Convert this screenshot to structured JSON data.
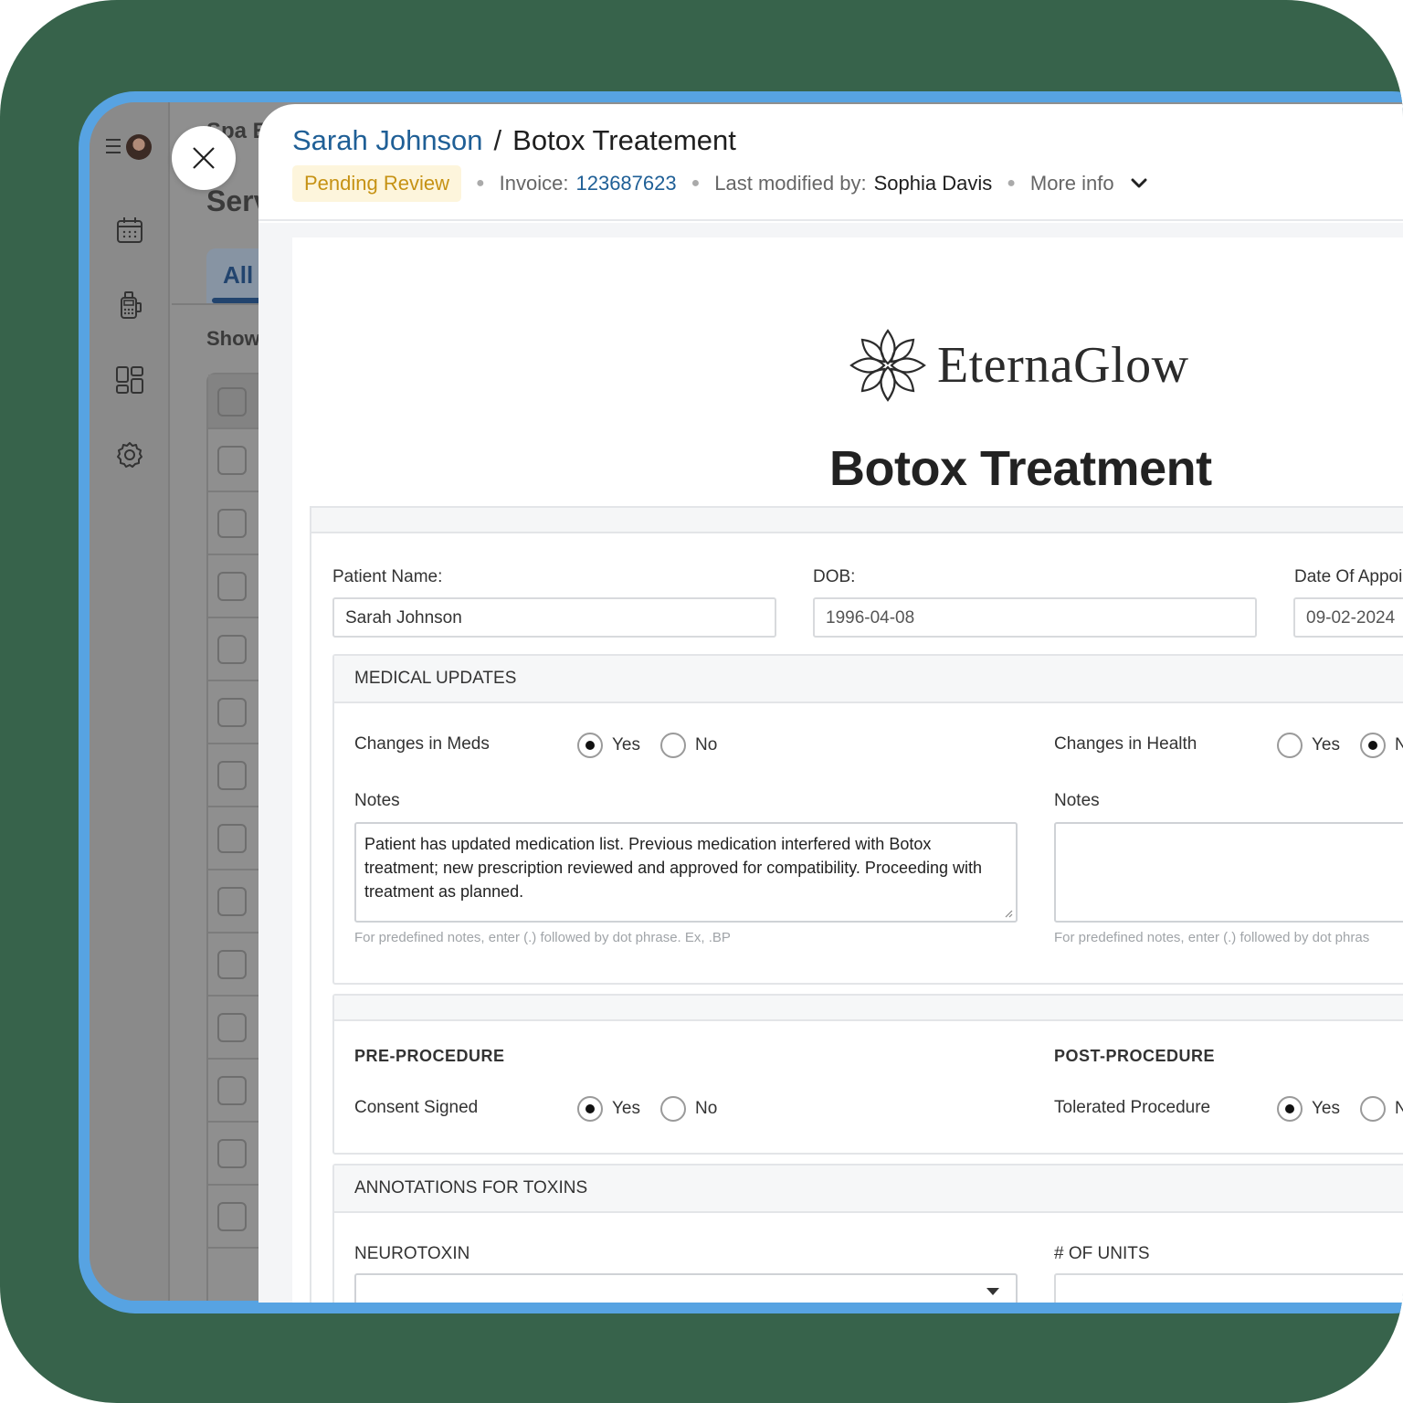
{
  "background_app": {
    "panel_title_partial": "Spa E",
    "heading_partial": "Serv",
    "active_tab_partial": "All",
    "show_partial": "Show",
    "rows": 14
  },
  "header": {
    "patient_name": "Sarah Johnson",
    "separator": "/",
    "form_title": "Botox Treatement",
    "status_badge": "Pending Review",
    "invoice_label": "Invoice:",
    "invoice_number": "123687623",
    "modified_label": "Last modified by:",
    "modified_by": "Sophia Davis",
    "more_info": "More info"
  },
  "document": {
    "brand_name": "EternaGlow",
    "title": "Botox Treatment",
    "patient_name_label": "Patient Name:",
    "patient_name_value": "Sarah Johnson",
    "dob_label": "DOB:",
    "dob_value": "1996-04-08",
    "appointment_label": "Date Of Appoi",
    "appointment_value": "09-02-2024",
    "medical_updates": {
      "heading": "MEDICAL UPDATES",
      "meds_label": "Changes in Meds",
      "meds_yes": "Yes",
      "meds_no": "No",
      "meds_selected": "Yes",
      "health_label": "Changes in Health",
      "health_yes": "Yes",
      "health_no": "N",
      "health_selected": "No",
      "notes_label_left": "Notes",
      "notes_left_value": "Patient has updated medication list. Previous medication interfered with Botox treatment; new prescription reviewed and approved for compatibility. Proceeding with treatment as planned.",
      "notes_label_right": "Notes",
      "notes_right_value": "",
      "hint_left": "For predefined notes, enter (.) followed by dot phrase. Ex, .BP",
      "hint_right": "For predefined notes, enter (.) followed by dot phras"
    },
    "procedure": {
      "pre_heading": "PRE-PROCEDURE",
      "consent_label": "Consent Signed",
      "consent_yes": "Yes",
      "consent_no": "No",
      "consent_selected": "Yes",
      "post_heading": "POST-PROCEDURE",
      "tolerated_label": "Tolerated Procedure",
      "tolerated_yes": "Yes",
      "tolerated_no": "N",
      "tolerated_selected": "Yes"
    },
    "toxins": {
      "heading": "ANNOTATIONS FOR TOXINS",
      "neurotoxin_label": "NEUROTOXIN",
      "neurotoxin_value": "",
      "units_label": "# OF UNITS",
      "units_value": ""
    }
  },
  "colors": {
    "frame_green": "#37634b",
    "device_blue": "#57a3e2",
    "link_blue": "#1f5f96",
    "badge_bg": "#fdf5dc",
    "badge_text": "#c69214"
  },
  "icons": [
    "menu-icon",
    "calendar-icon",
    "pos-terminal-icon",
    "grid-icon",
    "gear-icon",
    "close-icon",
    "chevron-down-icon",
    "lotus-logo-icon",
    "dropdown-caret-icon"
  ]
}
